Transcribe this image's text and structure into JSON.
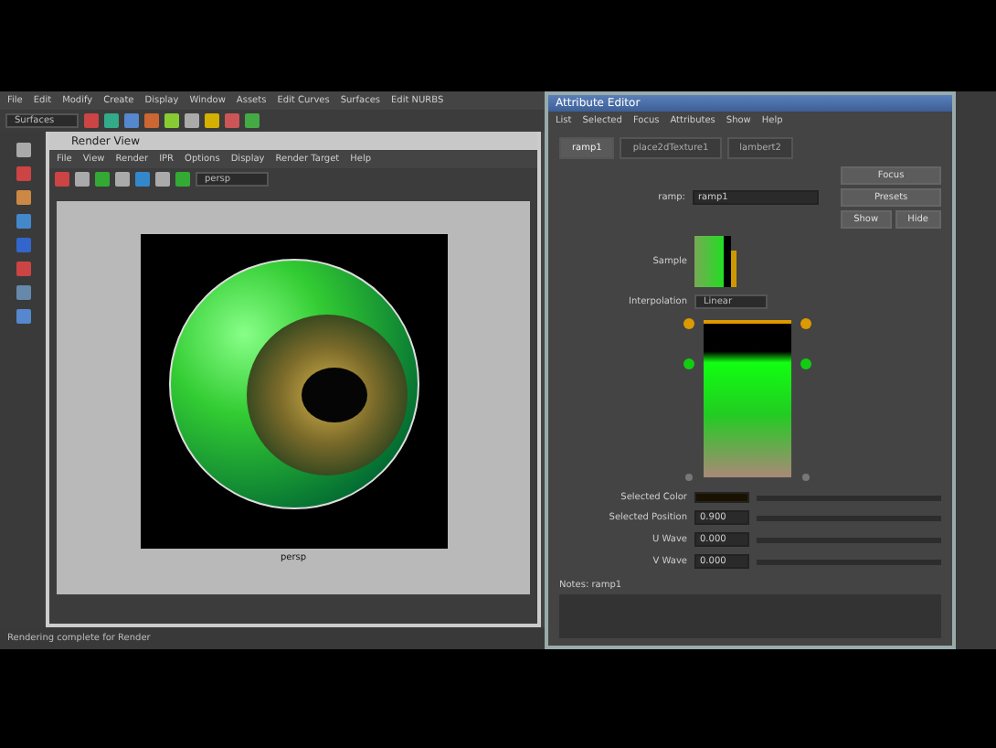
{
  "app_menu": [
    "File",
    "Edit",
    "Modify",
    "Create",
    "Display",
    "Window",
    "Assets",
    "Edit Curves",
    "Surfaces",
    "Edit NURBS"
  ],
  "workspace": "Surfaces",
  "render_view": {
    "title": "Render View",
    "menu": [
      "File",
      "View",
      "Render",
      "IPR",
      "Options",
      "Display",
      "Render Target",
      "Help"
    ],
    "camera": "persp",
    "caption": "persp"
  },
  "attribute_editor": {
    "title": "Attribute Editor",
    "menu": [
      "List",
      "Selected",
      "Focus",
      "Attributes",
      "Show",
      "Help"
    ],
    "tabs": [
      {
        "label": "ramp1",
        "selected": true
      },
      {
        "label": "place2dTexture1",
        "selected": false
      },
      {
        "label": "lambert2",
        "selected": false
      }
    ],
    "name_label": "ramp:",
    "name_value": "ramp1",
    "buttons": [
      "Focus",
      "Presets"
    ],
    "show_hide": [
      "Show",
      "Hide"
    ],
    "sample_label": "Sample",
    "interpolation_label": "Interpolation",
    "interpolation": "Linear",
    "fields": [
      {
        "kind": "color",
        "label": "Selected Color"
      },
      {
        "kind": "number",
        "label": "Selected Position",
        "value": "0.900"
      },
      {
        "kind": "number",
        "label": "U Wave",
        "value": "0.000"
      },
      {
        "kind": "number",
        "label": "V Wave",
        "value": "0.000"
      }
    ],
    "notes_label": "Notes: ramp1"
  },
  "status": "Rendering complete for Render"
}
